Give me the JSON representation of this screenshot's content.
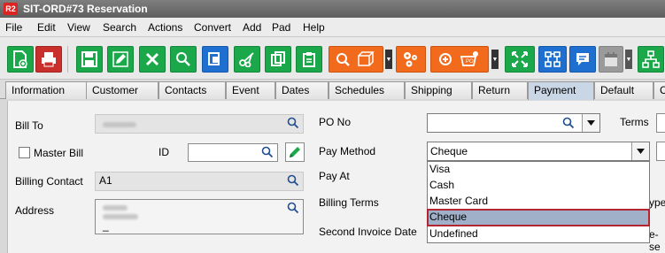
{
  "window": {
    "logo": "R2",
    "title": "SIT-ORD#73 Reservation"
  },
  "menu": [
    "File",
    "Edit",
    "View",
    "Search",
    "Actions",
    "Convert",
    "Add",
    "Pad",
    "Help"
  ],
  "tabs": [
    "Information",
    "Customer",
    "Contacts",
    "Event",
    "Dates",
    "Schedules",
    "Shipping",
    "Return",
    "Payment",
    "Default",
    "C"
  ],
  "active_tab": "Payment",
  "form": {
    "bill_to_label": "Bill To",
    "master_bill_label": "Master Bill",
    "id_label": "ID",
    "billing_contact_label": "Billing Contact",
    "billing_contact_value": "A1",
    "address_label": "Address",
    "address_cursor": "_",
    "po_no_label": "PO No",
    "terms_label": "Terms",
    "pay_method_label": "Pay Method",
    "pay_method_value": "Cheque",
    "pay_at_label": "Pay At",
    "billing_terms_label": "Billing Terms",
    "second_invoice_date_label": "Second Invoice Date",
    "cutoff_right_1": "ype",
    "cutoff_right_2": "e-se"
  },
  "pay_method_options": [
    "Visa",
    "Cash",
    "Master Card",
    "Cheque",
    "Undefined"
  ],
  "selected_option": "Cheque",
  "colors": {
    "toolbar_green": "#1aa84a",
    "toolbar_blue": "#1f6fd1",
    "toolbar_orange": "#f26a1b",
    "highlight_border": "#b3252f"
  }
}
